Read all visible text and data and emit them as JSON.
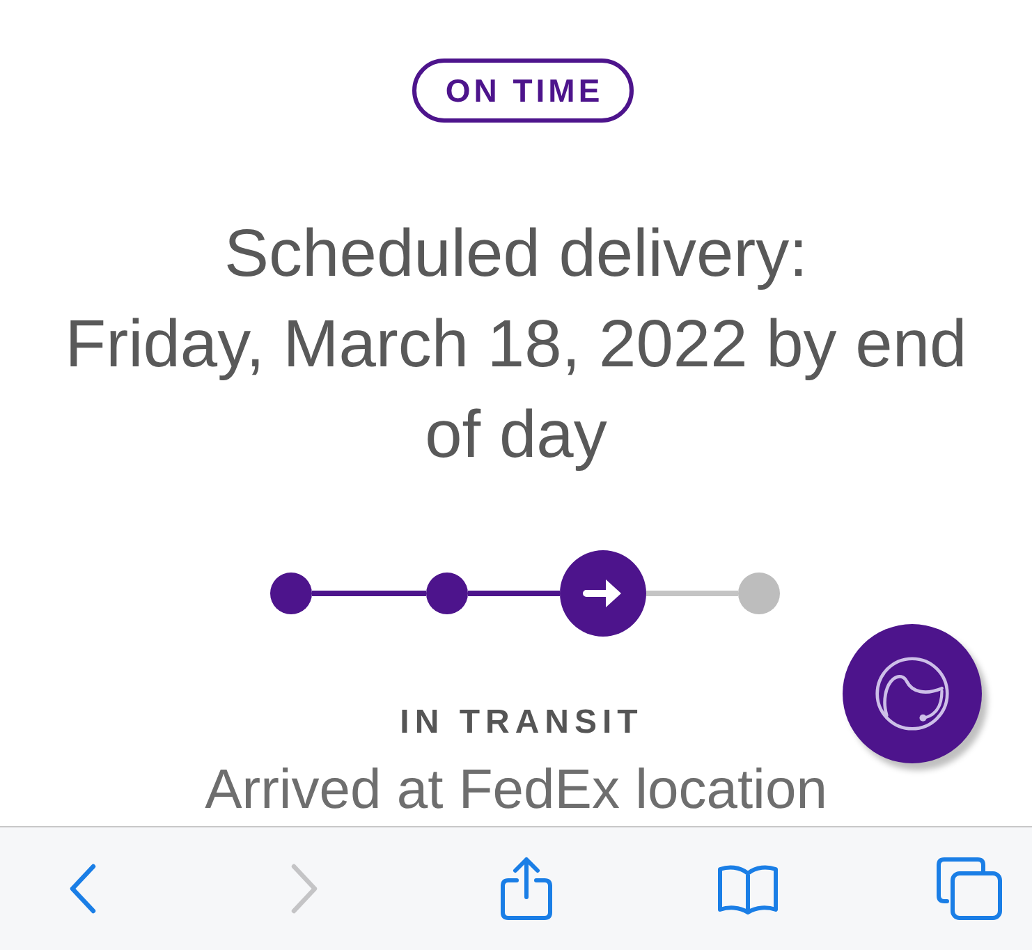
{
  "badge": {
    "label": "ON TIME"
  },
  "delivery": {
    "title": "Scheduled delivery:",
    "date": "Friday, March 18, 2022 by end of day"
  },
  "tracker": {
    "steps": [
      {
        "completed": true,
        "current": false
      },
      {
        "completed": true,
        "current": false
      },
      {
        "completed": false,
        "current": true
      },
      {
        "completed": false,
        "current": false
      }
    ]
  },
  "status": {
    "label": "IN TRANSIT",
    "detail": "Arrived at FedEx location"
  },
  "toolbar": {
    "back": {
      "disabled": false
    },
    "forward": {
      "disabled": true
    }
  }
}
